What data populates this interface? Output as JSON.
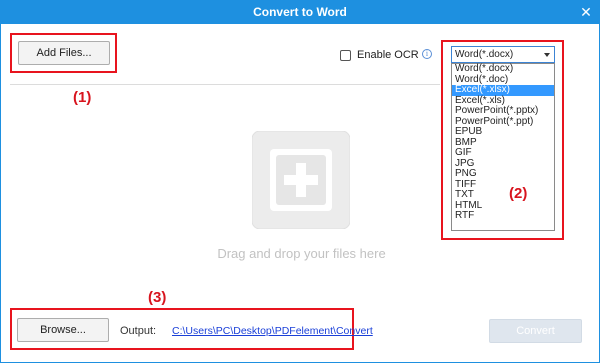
{
  "window": {
    "title": "Convert to Word",
    "close_glyph": "✕"
  },
  "toolbar": {
    "add_files_label": "Add Files...",
    "enable_ocr_label": "Enable OCR",
    "enable_ocr_checked": false,
    "info_icon_glyph": "i"
  },
  "format_select": {
    "selected": "Word(*.docx)",
    "options": [
      "Word(*.docx)",
      "Word(*.doc)",
      "Excel(*.xlsx)",
      "Excel(*.xls)",
      "PowerPoint(*.pptx)",
      "PowerPoint(*.ppt)",
      "EPUB",
      "BMP",
      "GIF",
      "JPG",
      "PNG",
      "TIFF",
      "TXT",
      "HTML",
      "RTF"
    ],
    "highlighted": "Excel(*.xlsx)"
  },
  "drop_zone": {
    "text": "Drag and drop your files here"
  },
  "footer": {
    "browse_label": "Browse...",
    "output_label": "Output:",
    "output_path": "C:\\Users\\PC\\Desktop\\PDFelement\\Convert",
    "convert_label": "Convert"
  },
  "annotations": {
    "label_1": "(1)",
    "label_2": "(2)",
    "label_3": "(3)"
  },
  "colors": {
    "accent": "#1e90e0",
    "annotation": "#e8141e",
    "link": "#1a3fd8",
    "highlight": "#3399ff"
  }
}
